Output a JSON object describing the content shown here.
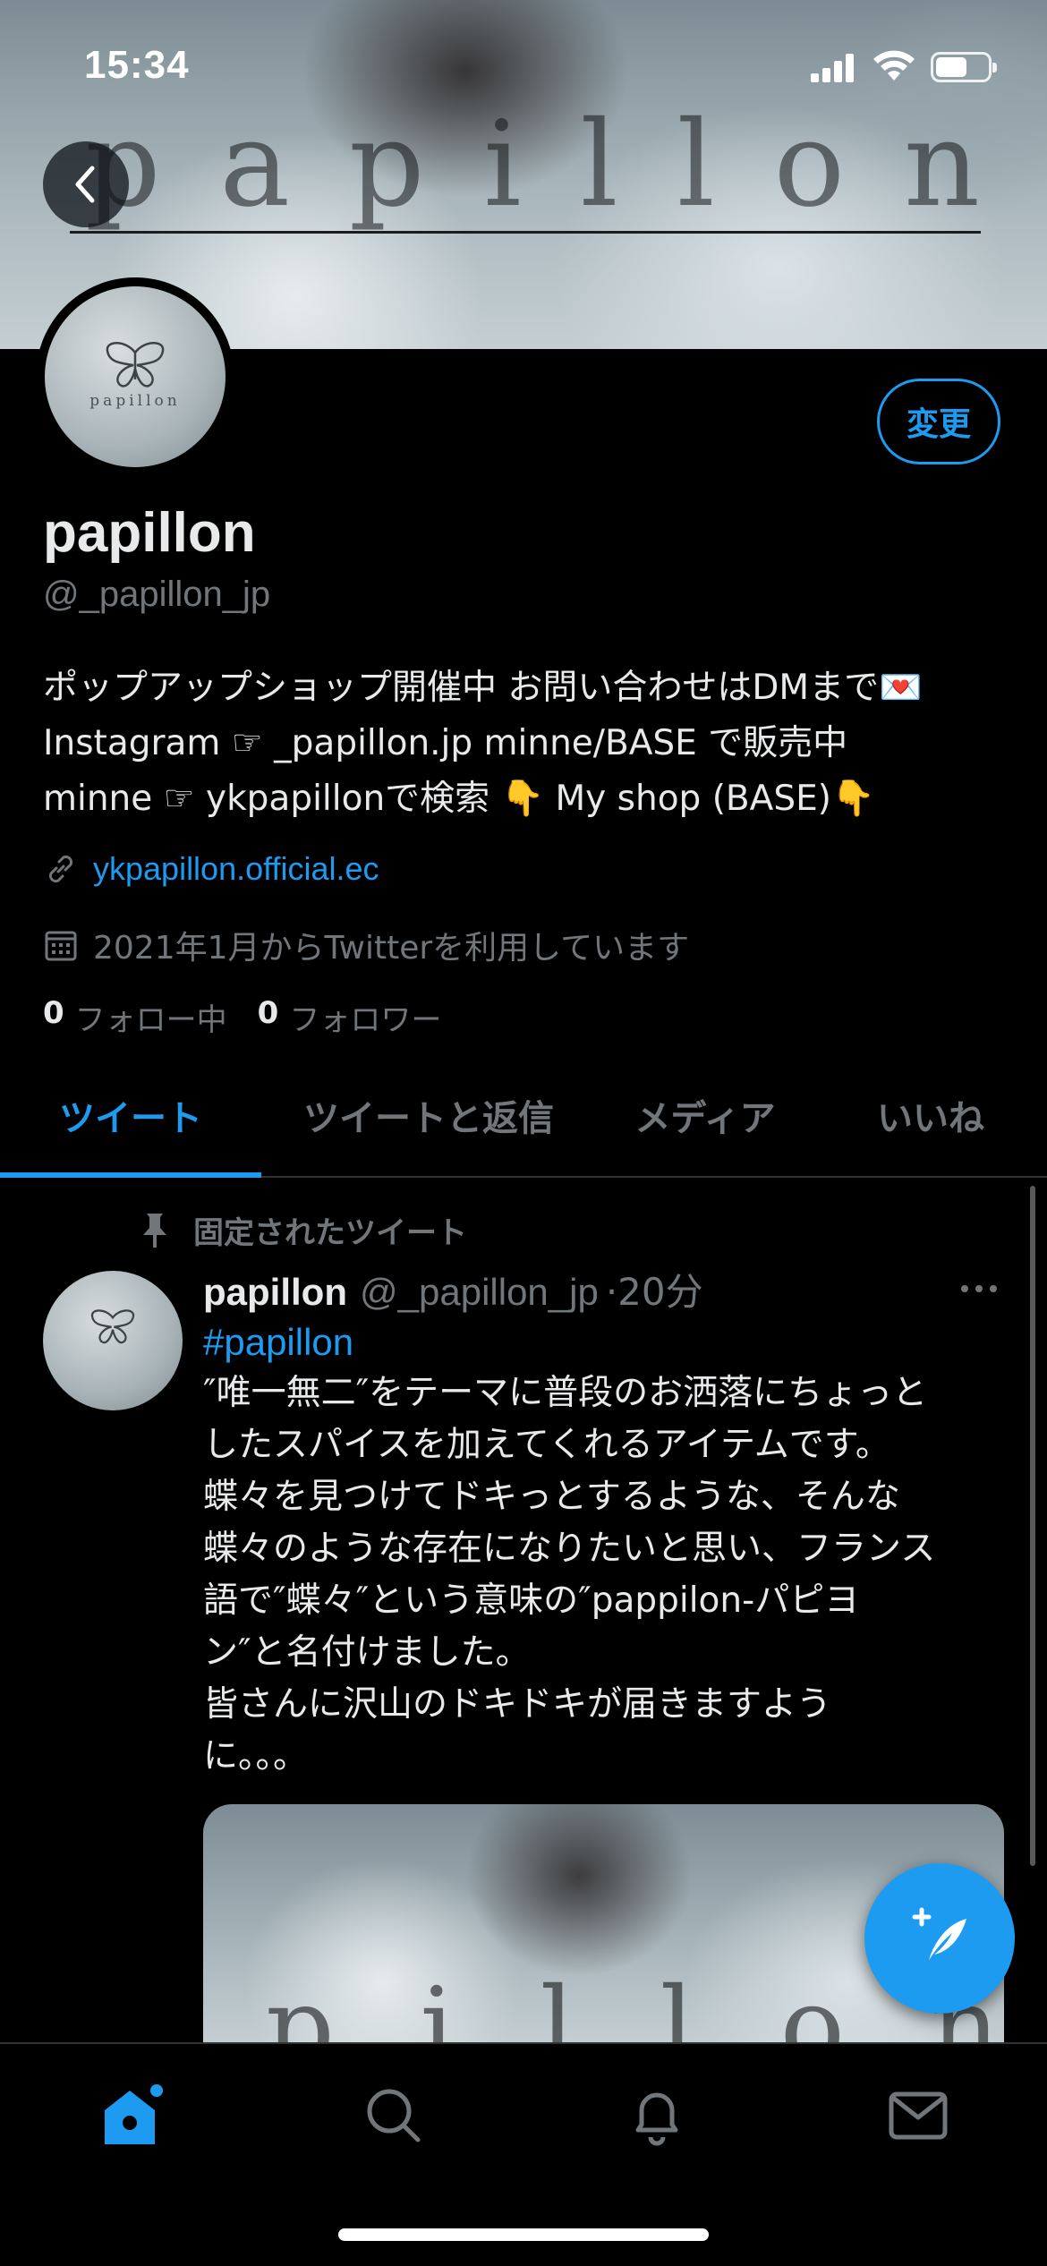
{
  "status_bar": {
    "time": "15:34"
  },
  "banner": {
    "word_letters": [
      "p",
      "a",
      "p",
      "i",
      "l",
      "l",
      "o",
      "n"
    ]
  },
  "profile": {
    "avatar_caption": "papillon",
    "edit_label": "変更",
    "name": "papillon",
    "handle": "@_papillon_jp",
    "bio_lines": [
      "ポップアップショップ開催中 お問い合わせはDMまで💌",
      "Instagram ☞ _papillon.jp minne/BASE で販売中",
      "minne ☞ ykpapillonで検索 👇 My shop (BASE)👇"
    ],
    "link": "ykpapillon.official.ec",
    "joined": "2021年1月からTwitterを利用しています",
    "following_count": "0",
    "following_label": "フォロー中",
    "followers_count": "0",
    "followers_label": "フォロワー"
  },
  "tabs": [
    {
      "label": "ツイート",
      "active": true
    },
    {
      "label": "ツイートと返信",
      "active": false
    },
    {
      "label": "メディア",
      "active": false
    },
    {
      "label": "いいね",
      "active": false
    }
  ],
  "pinned_tweet": {
    "pinned_label": "固定されたツイート",
    "name": "papillon",
    "handle": "@_papillon_jp",
    "time": "·20分",
    "hashtag": "#papillon",
    "text_lines": [
      "″唯一無二″をテーマに普段のお洒落にちょっと",
      "したスパイスを加えてくれるアイテムです。",
      "蝶々を見つけてドキっとするような、そんな",
      "蝶々のような存在になりたいと思い、フランス",
      "語で″蝶々″という意味の″pappilon-パピヨ",
      "ン″と名付けました。",
      "皆さんに沢山のドキドキが届きますよう",
      "に。。。"
    ],
    "media_letters": [
      "p",
      "i",
      "l",
      "l",
      "o",
      "n"
    ]
  },
  "colors": {
    "accent": "#1d9bf0",
    "muted": "#71767b",
    "background": "#000000",
    "text": "#e7e9ea"
  },
  "icons": {
    "back": "chevron-left-icon",
    "link": "link-icon",
    "calendar": "calendar-icon",
    "pin": "pin-icon",
    "more": "more-horizontal-icon",
    "compose": "compose-feather-icon",
    "nav": [
      "home-icon",
      "search-icon",
      "notifications-icon",
      "messages-icon"
    ]
  }
}
